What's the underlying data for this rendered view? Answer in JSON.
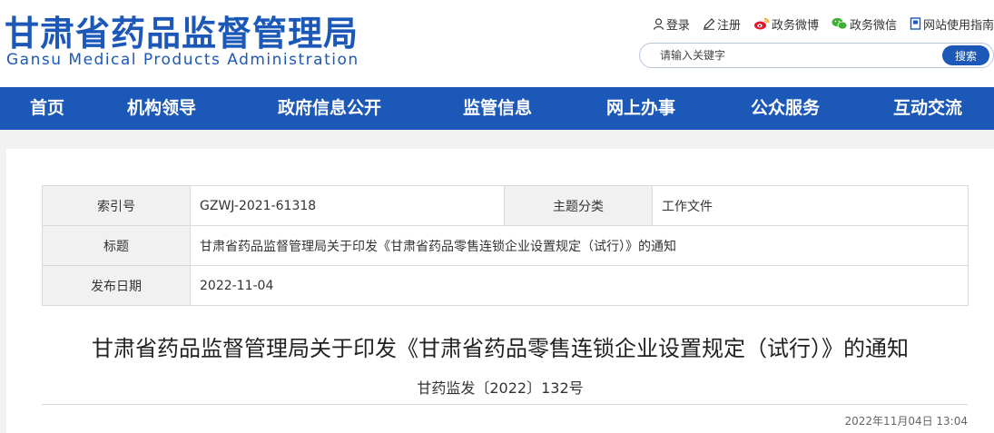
{
  "header": {
    "logo_cn": "甘肃省药品监督管理局",
    "logo_en": "Gansu Medical Products Administration",
    "top_links": [
      {
        "label": "登录",
        "icon": "user-icon"
      },
      {
        "label": "注册",
        "icon": "pencil-icon"
      },
      {
        "label": "政务微博",
        "icon": "weibo-icon"
      },
      {
        "label": "政务微信",
        "icon": "wechat-icon"
      },
      {
        "label": "网站使用指南",
        "icon": "guide-icon"
      }
    ],
    "search": {
      "placeholder": "请输入关键字",
      "button_label": "搜索"
    }
  },
  "nav": {
    "items": [
      "首页",
      "机构领导",
      "政府信息公开",
      "监管信息",
      "网上办事",
      "公众服务",
      "互动交流"
    ]
  },
  "meta": {
    "index_label": "索引号",
    "index_value": "GZWJ-2021-61318",
    "topic_label": "主题分类",
    "topic_value": "工作文件",
    "title_label": "标题",
    "title_value": "甘肃省药品监督管理局关于印发《甘肃省药品零售连锁企业设置规定（试行）》的通知",
    "date_label": "发布日期",
    "date_value": "2022-11-04"
  },
  "article": {
    "title": "甘肃省药品监督管理局关于印发《甘肃省药品零售连锁企业设置规定（试行）》的通知",
    "doc_number": "甘药监发〔2022〕132号",
    "publish_time": "2022年11月04日 13:04"
  },
  "colors": {
    "brand_blue": "#1b58b8"
  }
}
